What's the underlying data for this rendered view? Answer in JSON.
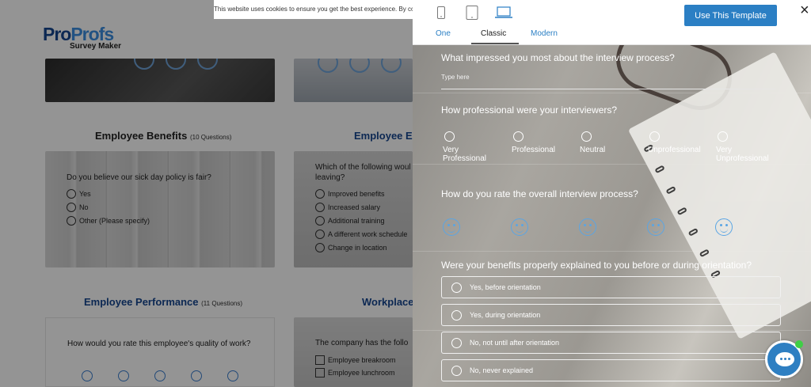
{
  "cookie_notice": "This website uses cookies to ensure you get the best experience. By continu",
  "logo": {
    "pro1": "Pro",
    "pro2": "Profs",
    "sub": "Survey Maker"
  },
  "background": {
    "benefits_title": "Employee Benefits",
    "benefits_count": "(10 Questions)",
    "benefits_question": "Do you believe our sick day policy is fair?",
    "benefits_options": [
      "Yes",
      "No",
      "Other (Please specify)"
    ],
    "exit_title": "Employee Ex",
    "exit_question_1": "Which of the following woul",
    "exit_question_2": "leaving?",
    "exit_options": [
      "Improved benefits",
      "Increased salary",
      "Additional training",
      "A different work schedule",
      "Change in location"
    ],
    "performance_title": "Employee Performance",
    "performance_count": "(11 Questions)",
    "performance_question": "How would you rate this employee's quality of work?",
    "workplace_title": "Workplace",
    "workplace_question": "The company has the follo",
    "workplace_options": [
      "Employee breakroom",
      "Employee lunchroom"
    ]
  },
  "panel": {
    "tabs": [
      "One",
      "Classic",
      "Modern"
    ],
    "active_tab": "Classic",
    "use_button": "Use This Template",
    "close": "×"
  },
  "preview": {
    "q1": "What impressed you most about the interview process?",
    "q1_placeholder": "Type here",
    "q2": "How professional were your interviewers?",
    "q2_options": [
      "Very",
      "Professional",
      "Professional",
      "Neutral",
      "Unprofessional",
      "Very",
      "Unprofessional"
    ],
    "q3": "How do you rate the overall interview process?",
    "q4": "Were your benefits properly explained to you before or during orientation?",
    "q4_options": [
      "Yes, before orientation",
      "Yes, during orientation",
      "No, not until after orientation",
      "No, never explained"
    ]
  },
  "colors": {
    "brand_blue": "#2b7fc4",
    "logo_dark": "#16468f",
    "chat_blue": "#2e7fc2",
    "online_green": "#3fcf45"
  }
}
